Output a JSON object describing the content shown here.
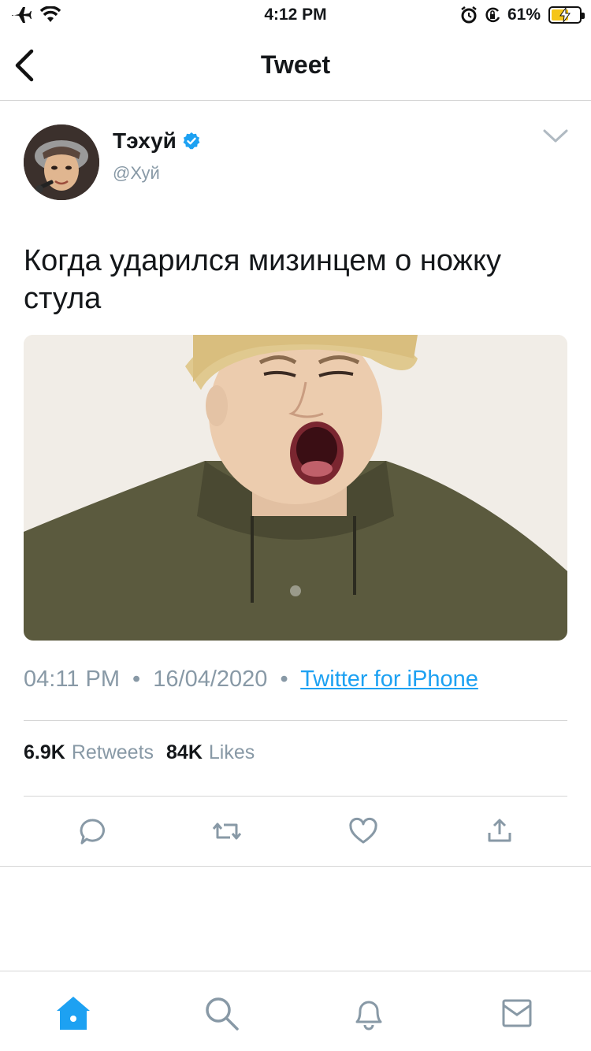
{
  "status_bar": {
    "time": "4:12 PM",
    "battery_text": "61%",
    "battery_level": 0.61,
    "icons": [
      "airplane-icon",
      "wifi-icon",
      "alarm-icon",
      "orientation-lock-icon",
      "battery-charging-icon"
    ]
  },
  "nav": {
    "title": "Tweet",
    "back_icon": "chevron-left-icon"
  },
  "tweet": {
    "author_name": "Тэхуй",
    "handle": "@Хуй",
    "verified": true,
    "text": "Когда ударился мизинцем о ножку стула",
    "time": "04:11 PM",
    "separator": "•",
    "date": "16/04/2020",
    "source": "Twitter for iPhone",
    "retweets_count": "6.9K",
    "retweets_label": "Retweets",
    "likes_count": "84K",
    "likes_label": "Likes"
  },
  "actions": [
    "reply-icon",
    "retweet-icon",
    "like-icon",
    "share-icon"
  ],
  "tabbar": [
    "home-icon",
    "search-icon",
    "notifications-icon",
    "messages-icon"
  ],
  "colors": {
    "accent": "#1da1f2",
    "text": "#14171a",
    "secondary": "#8899a6",
    "divider": "#d6d6d6"
  }
}
